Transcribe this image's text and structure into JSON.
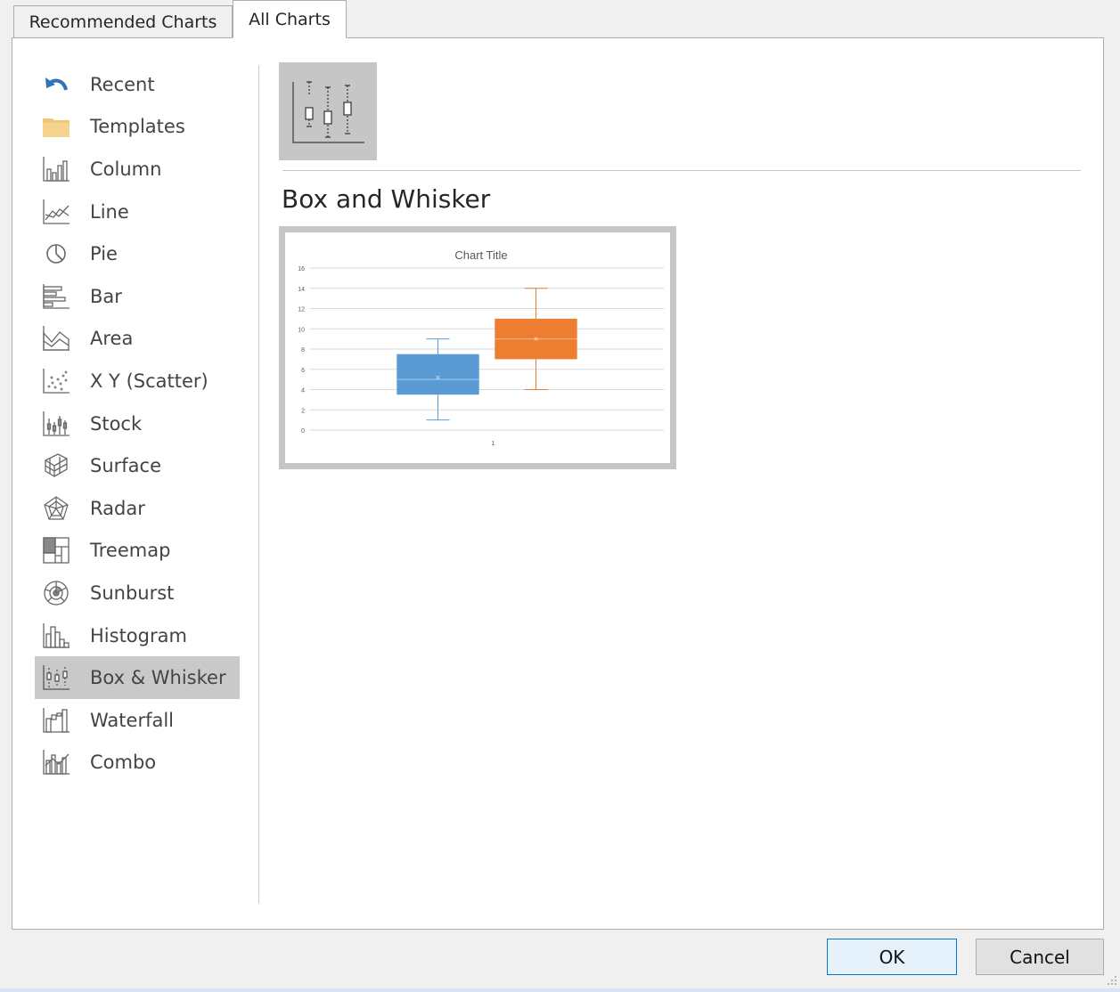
{
  "tabs": {
    "recommended": "Recommended Charts",
    "all": "All Charts"
  },
  "sidebar": {
    "items": [
      {
        "label": "Recent",
        "icon": "recent-icon"
      },
      {
        "label": "Templates",
        "icon": "templates-folder-icon"
      },
      {
        "label": "Column",
        "icon": "column-chart-icon"
      },
      {
        "label": "Line",
        "icon": "line-chart-icon"
      },
      {
        "label": "Pie",
        "icon": "pie-chart-icon"
      },
      {
        "label": "Bar",
        "icon": "bar-chart-icon"
      },
      {
        "label": "Area",
        "icon": "area-chart-icon"
      },
      {
        "label": "X Y (Scatter)",
        "icon": "scatter-chart-icon"
      },
      {
        "label": "Stock",
        "icon": "stock-chart-icon"
      },
      {
        "label": "Surface",
        "icon": "surface-chart-icon"
      },
      {
        "label": "Radar",
        "icon": "radar-chart-icon"
      },
      {
        "label": "Treemap",
        "icon": "treemap-chart-icon"
      },
      {
        "label": "Sunburst",
        "icon": "sunburst-chart-icon"
      },
      {
        "label": "Histogram",
        "icon": "histogram-chart-icon"
      },
      {
        "label": "Box & Whisker",
        "icon": "box-whisker-chart-icon",
        "selected": true
      },
      {
        "label": "Waterfall",
        "icon": "waterfall-chart-icon"
      },
      {
        "label": "Combo",
        "icon": "combo-chart-icon"
      }
    ]
  },
  "content": {
    "type_title": "Box and Whisker"
  },
  "chart_data": {
    "type": "box",
    "title": "Chart Title",
    "categories": [
      "1"
    ],
    "ylim": [
      0,
      16
    ],
    "yticks": [
      "0",
      "2",
      "4",
      "6",
      "8",
      "10",
      "12",
      "14",
      "16"
    ],
    "grid": true,
    "series": [
      {
        "color": "#5b9bd5",
        "min": 1,
        "q1": 3.5,
        "median": 5,
        "mean": 5.2,
        "q3": 7.5,
        "max": 9
      },
      {
        "color": "#ed7d31",
        "min": 4,
        "q1": 7,
        "median": 9,
        "mean": 9,
        "q3": 11,
        "max": 14
      }
    ]
  },
  "buttons": {
    "ok": "OK",
    "cancel": "Cancel"
  },
  "colors": {
    "accent": "#0078d7",
    "selected_bg": "#c9c9c9"
  }
}
